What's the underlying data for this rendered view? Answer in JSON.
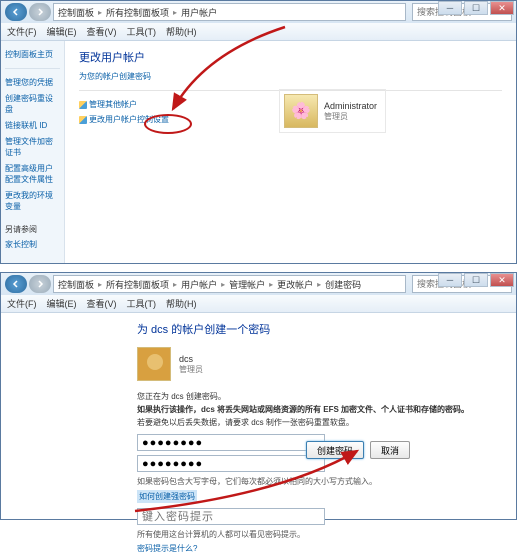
{
  "win1": {
    "breadcrumbs": [
      "控制面板",
      "所有控制面板项",
      "用户帐户"
    ],
    "search_placeholder": "搜索控制面板",
    "menu": [
      "文件(F)",
      "编辑(E)",
      "查看(V)",
      "工具(T)",
      "帮助(H)"
    ],
    "sidebar": {
      "items": [
        "控制面板主页",
        "管理您的凭据",
        "创建密码重设盘",
        "链接联机 ID",
        "管理文件加密证书",
        "配置高级用户配置文件属性",
        "更改我的环境变量"
      ],
      "footer_label": "另请参阅",
      "footer_item": "家长控制"
    },
    "heading": "更改用户帐户",
    "sub": "为您的帐户创建密码",
    "link_manage": "管理其他帐户",
    "link_uac": "更改用户帐户控制设置",
    "acct": {
      "name": "Administrator",
      "role": "管理员"
    }
  },
  "win2": {
    "breadcrumbs": [
      "控制面板",
      "所有控制面板项",
      "用户帐户",
      "管理帐户",
      "更改帐户",
      "创建密码"
    ],
    "search_placeholder": "搜索控制面板",
    "menu": [
      "文件(F)",
      "编辑(E)",
      "查看(V)",
      "工具(T)",
      "帮助(H)"
    ],
    "heading": "为 dcs 的帐户创建一个密码",
    "acct": {
      "name": "dcs",
      "role": "管理员"
    },
    "line_you": "您正在为 dcs 创建密码。",
    "line_warn": "如果执行该操作，dcs 将丢失网站或网络资源的所有 EFS 加密文件、个人证书和存储的密码。",
    "line_avoid": "若要避免以后丢失数据，请要求 dcs 制作一张密码重置软盘。",
    "pwd_value": "●●●●●●●●",
    "pwd2_value": "●●●●●●●●",
    "hint_good": "如果密码包含大写字母，它们每次都必须以相同的大小写方式输入。",
    "hint_link": "如何创建强密码",
    "hint_input_ph": "键入密码提示",
    "hint_visible": "所有使用这台计算机的人都可以看见密码提示。",
    "hint_what": "密码提示是什么?",
    "btn_create": "创建密码",
    "btn_cancel": "取消"
  }
}
